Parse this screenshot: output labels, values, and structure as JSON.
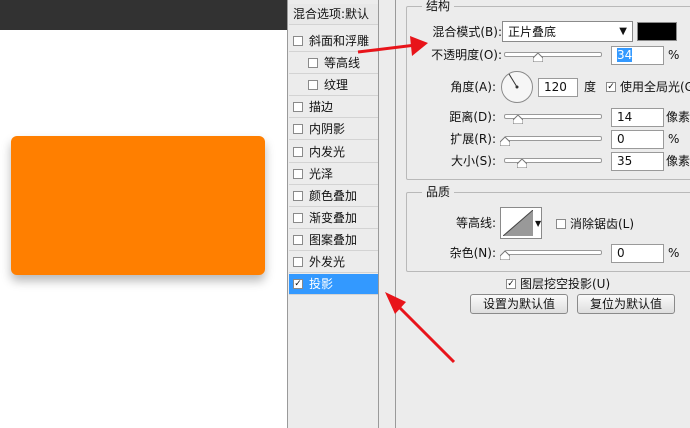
{
  "layer_list": {
    "header": "混合选项:默认",
    "items": [
      {
        "label": "斜面和浮雕",
        "checked": false,
        "sub": false,
        "selected": false
      },
      {
        "label": "等高线",
        "checked": false,
        "sub": true,
        "selected": false
      },
      {
        "label": "纹理",
        "checked": false,
        "sub": true,
        "selected": false
      },
      {
        "label": "描边",
        "checked": false,
        "sub": false,
        "selected": false
      },
      {
        "label": "内阴影",
        "checked": false,
        "sub": false,
        "selected": false
      },
      {
        "label": "内发光",
        "checked": false,
        "sub": false,
        "selected": false
      },
      {
        "label": "光泽",
        "checked": false,
        "sub": false,
        "selected": false
      },
      {
        "label": "颜色叠加",
        "checked": false,
        "sub": false,
        "selected": false
      },
      {
        "label": "渐变叠加",
        "checked": false,
        "sub": false,
        "selected": false
      },
      {
        "label": "图案叠加",
        "checked": false,
        "sub": false,
        "selected": false
      },
      {
        "label": "外发光",
        "checked": false,
        "sub": false,
        "selected": false
      },
      {
        "label": "投影",
        "checked": true,
        "sub": false,
        "selected": true
      }
    ]
  },
  "structure": {
    "title": "结构",
    "blend_mode_label": "混合模式(B):",
    "blend_mode_value": "正片叠底",
    "blend_color": "#000000",
    "opacity_label": "不透明度(O):",
    "opacity_value": "34",
    "opacity_unit": "%",
    "angle_label": "角度(A):",
    "angle_value": "120",
    "angle_unit": "度",
    "global_light_label": "使用全局光(G",
    "global_light_checked": true,
    "distance_label": "距离(D):",
    "distance_value": "14",
    "distance_unit": "像素",
    "spread_label": "扩展(R):",
    "spread_value": "0",
    "spread_unit": "%",
    "size_label": "大小(S):",
    "size_value": "35",
    "size_unit": "像素"
  },
  "quality": {
    "title": "品质",
    "contour_label": "等高线:",
    "antialias_label": "消除锯齿(L)",
    "antialias_checked": false,
    "noise_label": "杂色(N):",
    "noise_value": "0",
    "noise_unit": "%"
  },
  "knockout_label": "图层挖空投影(U)",
  "knockout_checked": true,
  "buttons": {
    "set_default": "设置为默认值",
    "reset_default": "复位为默认值"
  },
  "shape_color": "#ff7f00"
}
